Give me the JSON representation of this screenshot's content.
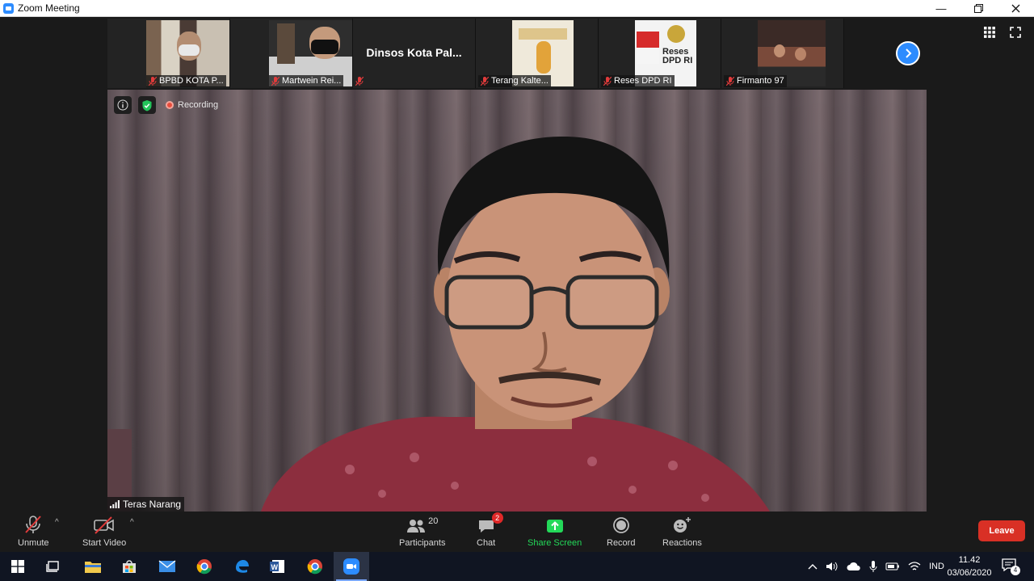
{
  "window": {
    "title": "Zoom Meeting"
  },
  "participants_strip": [
    {
      "name": "BPBD KOTA P..."
    },
    {
      "name": "Martwein Rei..."
    },
    {
      "name": "Dinsos   Kota Pal...",
      "name_only": true
    },
    {
      "name": "Terang Kalte..."
    },
    {
      "name": "Reses DPD RI"
    },
    {
      "name": "Firmanto 97"
    }
  ],
  "video": {
    "recording_label": "Recording",
    "speaker_name": "Teras Narang"
  },
  "toolbar": {
    "unmute": "Unmute",
    "start_video": "Start Video",
    "participants": "Participants",
    "participants_count": "20",
    "chat": "Chat",
    "chat_badge": "2",
    "share_screen": "Share Screen",
    "record": "Record",
    "reactions": "Reactions",
    "leave": "Leave"
  },
  "taskbar": {
    "language": "IND",
    "time": "11.42",
    "date": "03/06/2020",
    "notification_count": "4"
  },
  "colors": {
    "accent": "#2d8cff",
    "share_green": "#23d959",
    "leave_red": "#d93025",
    "chat_badge_red": "#e02828"
  }
}
